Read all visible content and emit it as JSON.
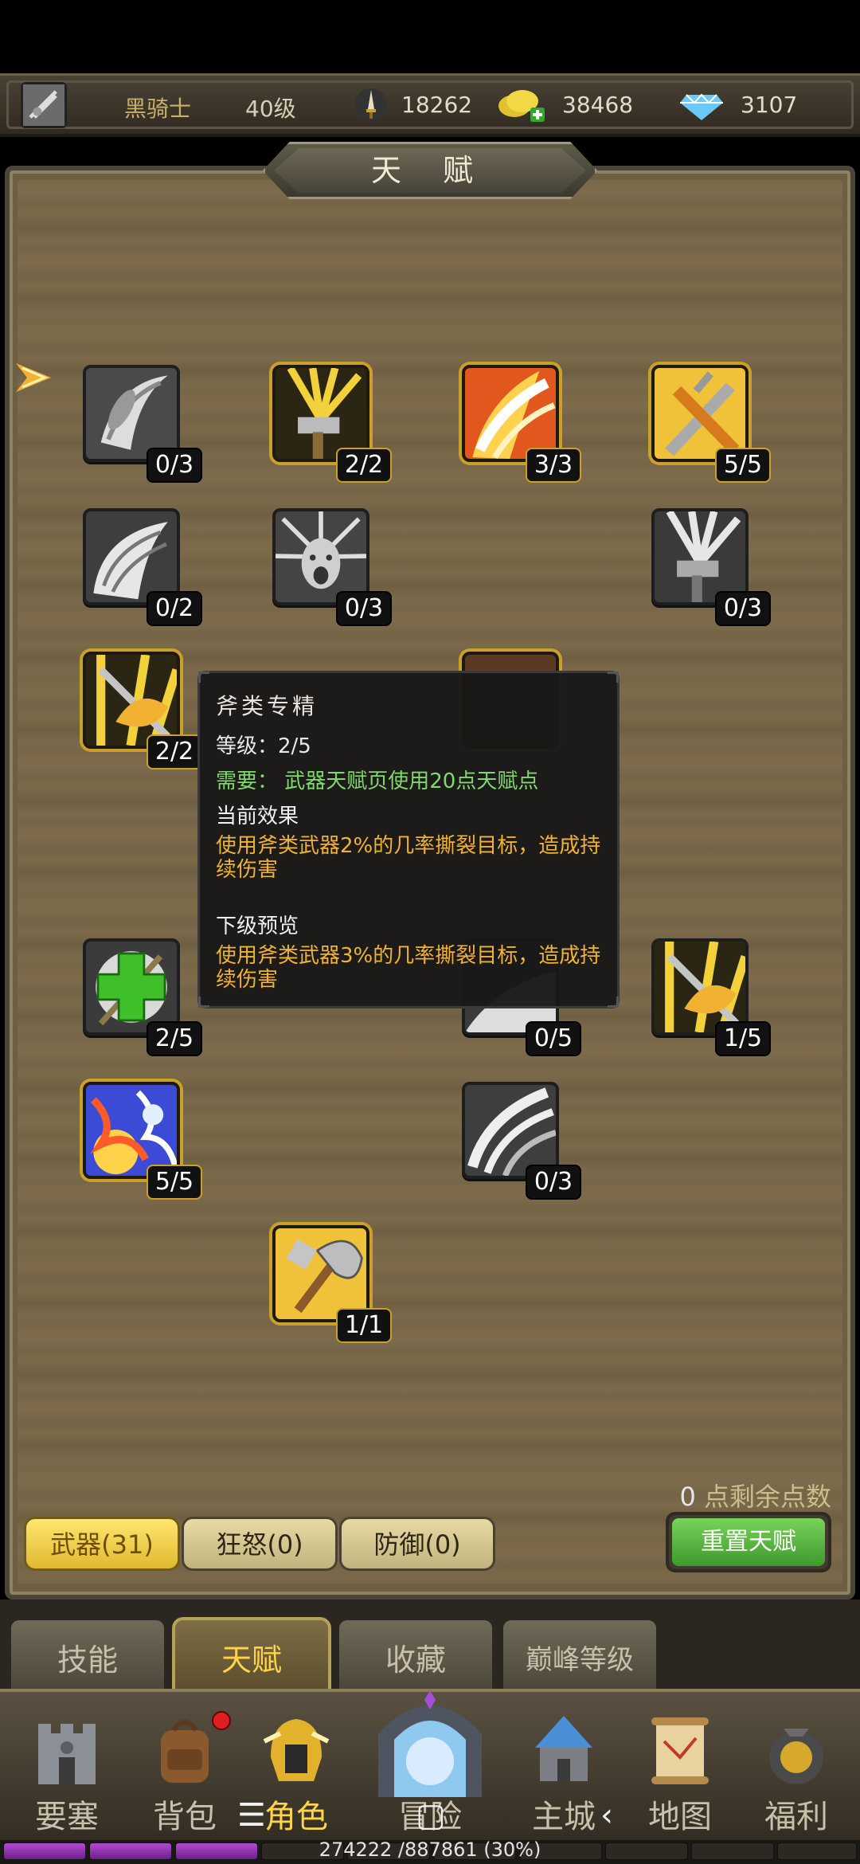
{
  "topbar": {
    "name": "黑骑士",
    "level": "40级",
    "resources": [
      {
        "icon": "sword-power-icon",
        "value": "18262"
      },
      {
        "icon": "gold-coins-icon",
        "value": "38468"
      },
      {
        "icon": "diamond-icon",
        "value": "3107"
      }
    ]
  },
  "panel": {
    "title": "天 赋",
    "remaining_value": "0",
    "remaining_label": " 点剩余点数",
    "pages": [
      "武器(31)",
      "狂怒(0)",
      "防御(0)"
    ],
    "reset_label": "重置天赋"
  },
  "talents": [
    {
      "icon": "swirl-blade-icon",
      "count": "0/3"
    },
    {
      "icon": "hammer-burst-icon",
      "count": "2/2"
    },
    {
      "icon": "fire-slash-icon",
      "count": "3/3"
    },
    {
      "icon": "crossed-swords-icon",
      "count": "5/5"
    },
    {
      "icon": "wing-slash-icon",
      "count": "0/2"
    },
    {
      "icon": "roar-face-icon",
      "count": "0/3"
    },
    {
      "icon": "hammer-gray-icon",
      "count": "0/3"
    },
    {
      "icon": "axe-specialist-icon",
      "count": "2/2"
    },
    {
      "icon": "heal-cross-icon",
      "count": "2/5"
    },
    {
      "icon": "partial-hidden-icon",
      "count": "0/5"
    },
    {
      "icon": "axe-yellow-icon",
      "count": "1/5"
    },
    {
      "icon": "elemental-storm-icon",
      "count": "5/5"
    },
    {
      "icon": "triple-slash-icon",
      "count": "0/3"
    },
    {
      "icon": "battle-axe-icon",
      "count": "1/1"
    }
  ],
  "tooltip": {
    "title": "斧类专精",
    "level": "等级：2/5",
    "requirement": "需要：   武器天赋页使用20点天赋点",
    "current_head": "当前效果",
    "current_text": "使用斧类武器2%的几率撕裂目标，造成持续伤害",
    "next_head": "下级预览",
    "next_text": "使用斧类武器3%的几率撕裂目标，造成持续伤害"
  },
  "tabs": [
    "技能",
    "天赋",
    "收藏",
    "巅峰等级"
  ],
  "nav": [
    "要塞",
    "背包",
    "角色",
    "冒险",
    "主城",
    "地图",
    "福利"
  ],
  "xp": {
    "text": "274222 /887861 (30%)",
    "fraction": 0.3
  },
  "colors": {
    "accent_gold": "#ffd34a",
    "green_button": "#4caa32",
    "tooltip_green": "#7fd96b",
    "tooltip_orange": "#f2b233"
  }
}
